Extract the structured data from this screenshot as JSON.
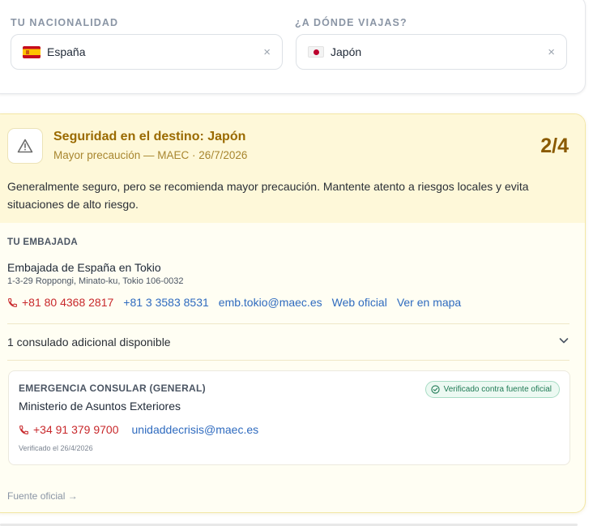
{
  "selectors": {
    "nationality_label": "TU NACIONALIDAD",
    "nationality_value": "España",
    "destination_label": "¿A DÓNDE VIAJAS?",
    "destination_value": "Japón",
    "clear_symbol": "×"
  },
  "safety": {
    "title": "Seguridad en el destino: Japón",
    "subtitle": "Mayor precaución — MAEC · 26/7/2026",
    "level": "2/4",
    "description": "Generalmente seguro, pero se recomienda mayor precaución. Mantente atento a riesgos locales y evita situaciones de alto riesgo.",
    "colors": {
      "title": "#9a6a00",
      "level": "#8a5a00",
      "header_bg": "#fef8d9"
    }
  },
  "embassy": {
    "section_label": "TU EMBAJADA",
    "name": "Embajada de España en Tokio",
    "address": "1-3-29 Roppongi, Minato-ku, Tokio 106-0032",
    "phone_primary": "+81 80 4368 2817",
    "phone_secondary": "+81 3 3583 8531",
    "email": "emb.tokio@maec.es",
    "website_label": "Web oficial",
    "map_label": "Ver en mapa"
  },
  "consulates": {
    "summary": "1 consulado adicional disponible"
  },
  "emergency": {
    "label": "EMERGENCIA CONSULAR (GENERAL)",
    "name": "Ministerio de Asuntos Exteriores",
    "badge": "Verificado contra fuente oficial",
    "phone": "+34 91 379 9700",
    "email": "unidaddecrisis@maec.es",
    "verified_date": "Verificado el 26/4/2026"
  },
  "footer": {
    "source_link": "Fuente oficial →"
  },
  "icons": [
    "warning-icon",
    "phone-icon",
    "chevron-down-icon",
    "check-circle-icon",
    "flag-spain-icon",
    "flag-japan-icon",
    "close-icon"
  ]
}
